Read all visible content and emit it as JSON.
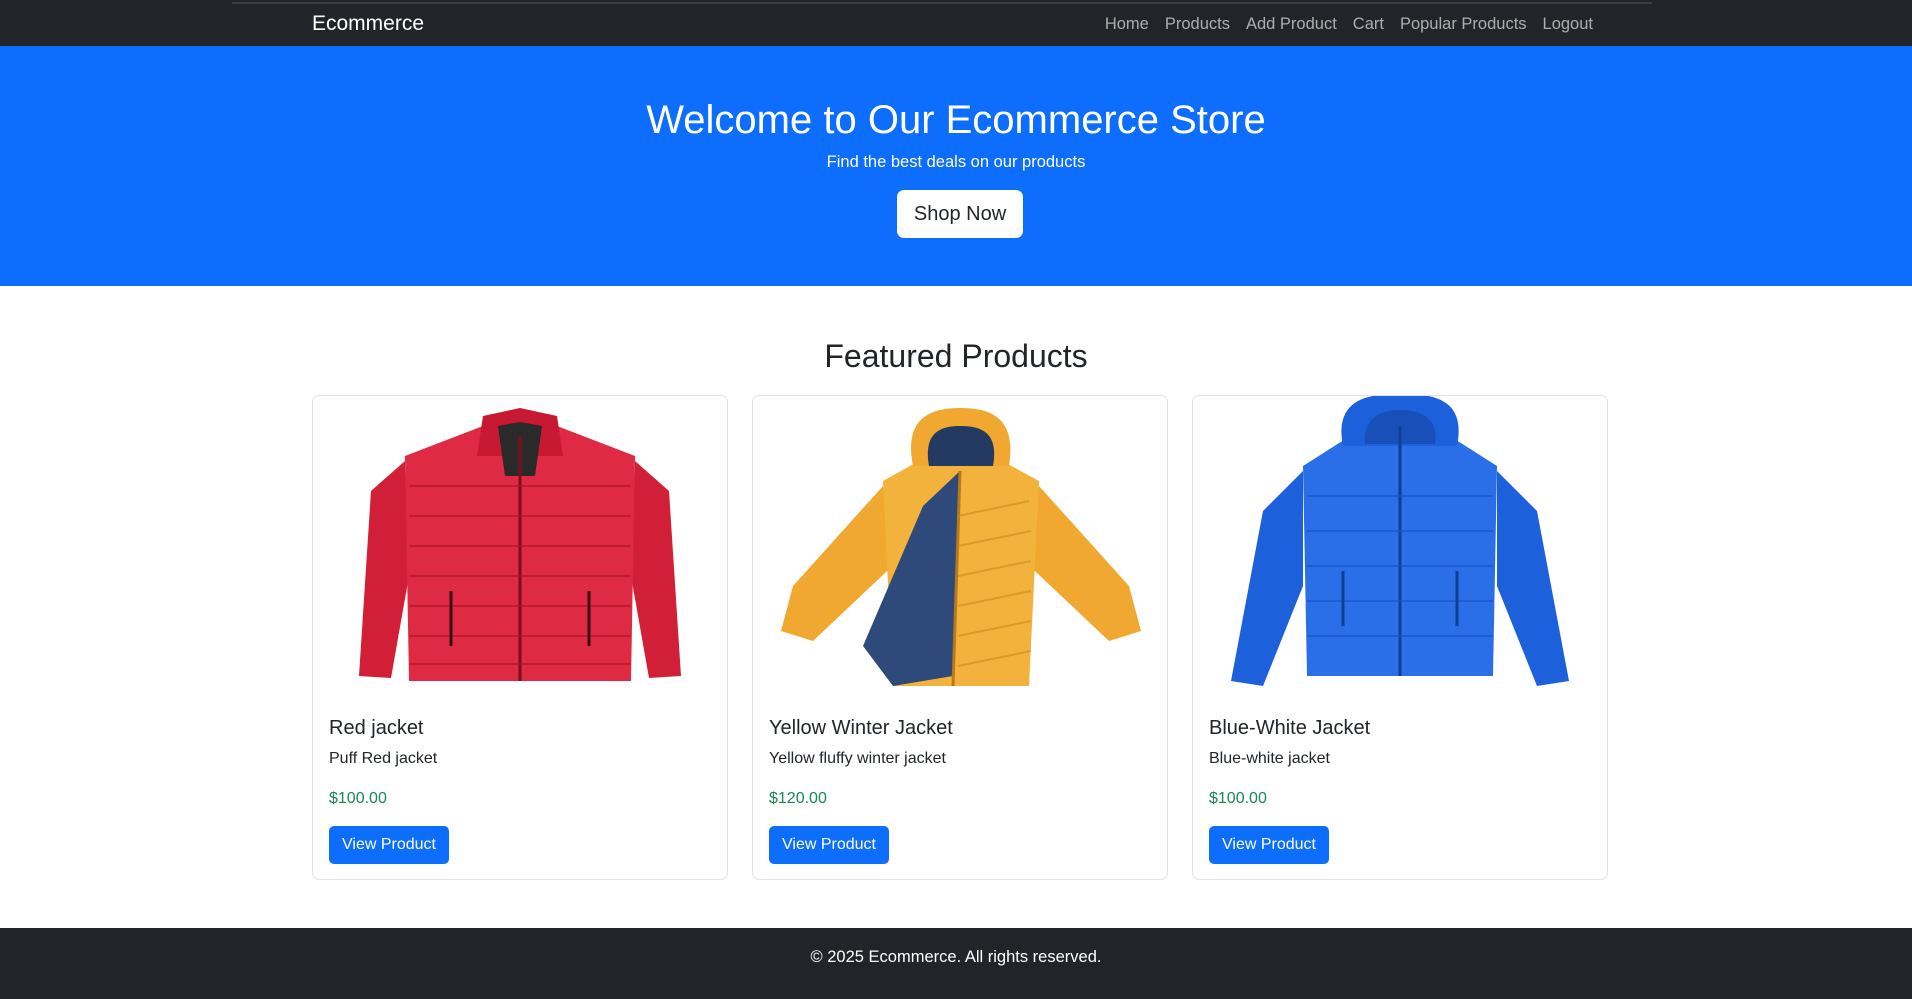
{
  "navbar": {
    "brand": "Ecommerce",
    "links": [
      {
        "label": "Home"
      },
      {
        "label": "Products"
      },
      {
        "label": "Add Product"
      },
      {
        "label": "Cart"
      },
      {
        "label": "Popular Products"
      },
      {
        "label": "Logout"
      }
    ]
  },
  "hero": {
    "title": "Welcome to Our Ecommerce Store",
    "subtitle": "Find the best deals on our products",
    "cta_label": "Shop Now"
  },
  "featured": {
    "title": "Featured Products",
    "products": [
      {
        "name": "Red jacket",
        "description": "Puff Red jacket",
        "price": "$100.00",
        "button_label": "View Product",
        "color": "#d9243b"
      },
      {
        "name": "Yellow Winter Jacket",
        "description": "Yellow fluffy winter jacket",
        "price": "$120.00",
        "button_label": "View Product",
        "color": "#f2ae35"
      },
      {
        "name": "Blue-White Jacket",
        "description": "Blue-white jacket",
        "price": "$100.00",
        "button_label": "View Product",
        "color": "#1f64e0"
      }
    ],
    "carousel": {
      "prev_icon": "chevron-left-icon",
      "next_icon": "chevron-right-icon"
    }
  },
  "footer": {
    "text": "© 2025 Ecommerce. All rights reserved."
  },
  "colors": {
    "primary": "#0d6efd",
    "dark": "#212529",
    "price_green": "#198754"
  }
}
